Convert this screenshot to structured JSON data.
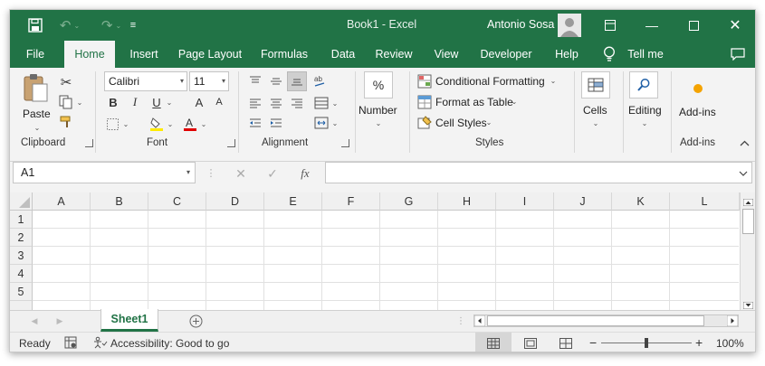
{
  "app": {
    "document_title": "Book1  -  Excel",
    "user_name": "Antonio Sosa",
    "accent_color": "#217346"
  },
  "quick_access": {
    "icons": [
      "save-icon",
      "undo-icon",
      "redo-icon",
      "customize-icon"
    ]
  },
  "window_controls": [
    "ribbon-display-icon",
    "minimize-icon",
    "maximize-icon",
    "close-icon"
  ],
  "menu_tabs": [
    "File",
    "Home",
    "Insert",
    "Page Layout",
    "Formulas",
    "Data",
    "Review",
    "View",
    "Developer",
    "Help",
    "Tell me"
  ],
  "active_tab": "Home",
  "ribbon": {
    "clipboard": {
      "paste_label": "Paste",
      "group_label": "Clipboard"
    },
    "font": {
      "font_name": "Calibri",
      "font_size": "11",
      "bold": "B",
      "italic": "I",
      "underline": "U",
      "grow": "A",
      "shrink": "A",
      "group_label": "Font"
    },
    "alignment": {
      "group_label": "Alignment"
    },
    "number": {
      "label": "Number",
      "symbol": "%"
    },
    "styles": {
      "conditional_formatting": "Conditional Formatting",
      "format_as_table": "Format as Table",
      "cell_styles": "Cell Styles",
      "group_label": "Styles"
    },
    "cells": {
      "label": "Cells"
    },
    "editing": {
      "label": "Editing"
    },
    "addins": {
      "label": "Add-ins",
      "group_label": "Add-ins"
    }
  },
  "formula_bar": {
    "name_box_value": "A1",
    "fx_label": "fx",
    "formula_value": ""
  },
  "grid": {
    "columns": [
      "A",
      "B",
      "C",
      "D",
      "E",
      "F",
      "G",
      "H",
      "I",
      "J",
      "K",
      "L"
    ],
    "rows": [
      "1",
      "2",
      "3",
      "4",
      "5"
    ],
    "selected_cell": "A1"
  },
  "sheets": {
    "tabs": [
      "Sheet1"
    ],
    "active": "Sheet1"
  },
  "status_bar": {
    "mode": "Ready",
    "accessibility": "Accessibility: Good to go",
    "zoom_percent": "100%",
    "zoom_minus": "−",
    "zoom_plus": "+"
  }
}
